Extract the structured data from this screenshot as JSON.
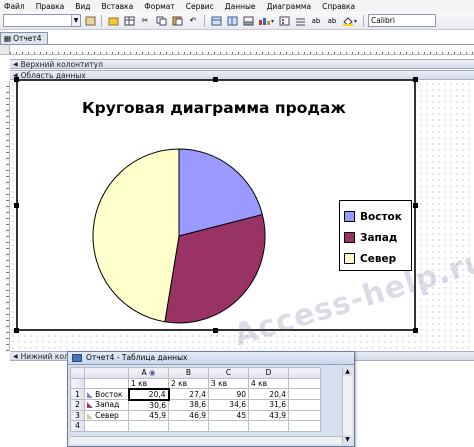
{
  "menu": [
    "Файл",
    "Правка",
    "Вид",
    "Вставка",
    "Формат",
    "Сервис",
    "Данные",
    "Диаграмма",
    "Справка"
  ],
  "toolbar": {
    "font_name": "Calibri"
  },
  "document_tab": "Отчет4",
  "sections": {
    "page_header": "Верхний колонтитул",
    "detail": "Область данных",
    "page_footer": "Нижний колонт"
  },
  "chart_data": {
    "type": "pie",
    "title": "Круговая диаграмма продаж",
    "categories": [
      "Восток",
      "Запад",
      "Север"
    ],
    "values": [
      20.4,
      30.6,
      45.9
    ],
    "colors": [
      "#9999ff",
      "#993366",
      "#ffffcc"
    ],
    "legend": "right"
  },
  "datasheet": {
    "title": "Отчет4 - Таблица данных",
    "col_letters": [
      "A",
      "B",
      "C",
      "D"
    ],
    "col_headers": [
      "1 кв",
      "2 кв",
      "3 кв",
      "4 кв"
    ],
    "rows": [
      {
        "num": "1",
        "name": "Восток",
        "values": [
          "20,4",
          "27,4",
          "90",
          "20,4"
        ]
      },
      {
        "num": "2",
        "name": "Запад",
        "values": [
          "30,6",
          "38,6",
          "34,6",
          "31,6"
        ]
      },
      {
        "num": "3",
        "name": "Север",
        "values": [
          "45,9",
          "46,9",
          "45",
          "43,9"
        ]
      },
      {
        "num": "4",
        "name": "",
        "values": [
          "",
          "",
          "",
          ""
        ]
      }
    ]
  },
  "watermark": "Access-help.ru"
}
